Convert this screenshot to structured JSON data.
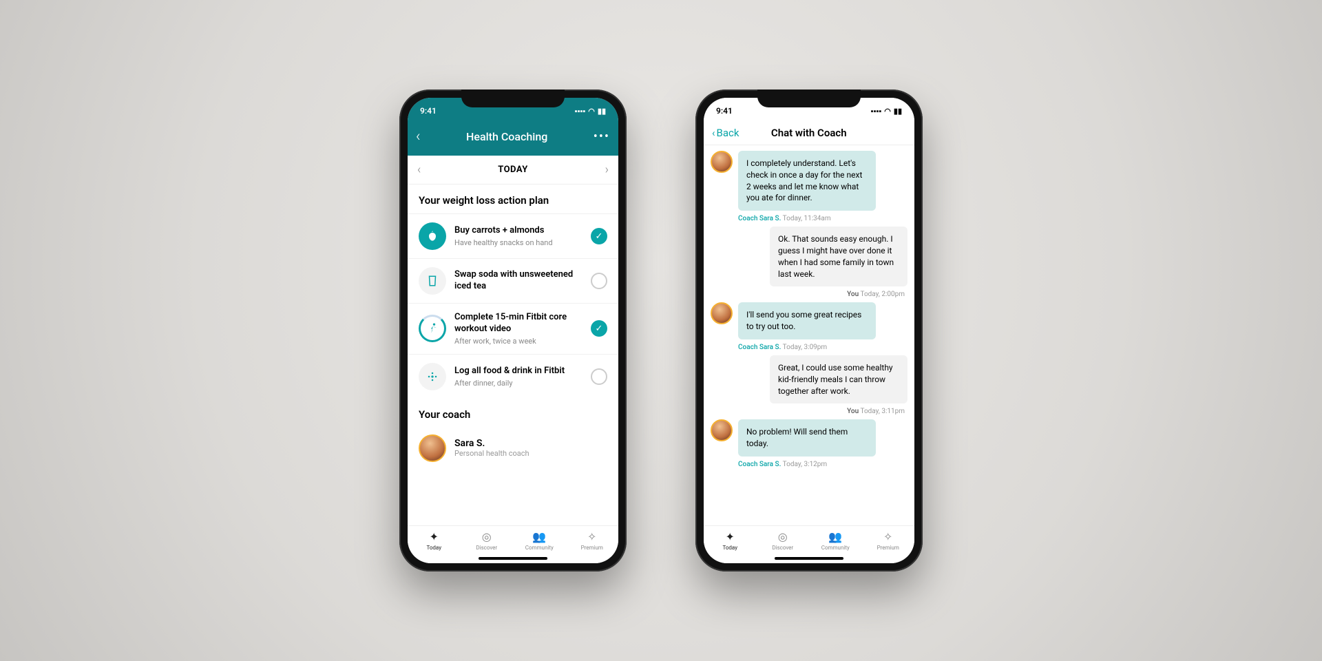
{
  "status_time": "9:41",
  "phone1": {
    "header_title": "Health Coaching",
    "day_label": "TODAY",
    "section_plan": "Your weight loss action plan",
    "tasks": [
      {
        "title": "Buy carrots + almonds",
        "sub": "Have healthy snacks on hand",
        "done": true,
        "icon": "apple"
      },
      {
        "title": "Swap soda with unsweetened iced tea",
        "sub": "",
        "done": false,
        "icon": "drink"
      },
      {
        "title": "Complete 15-min Fitbit core workout video",
        "sub": "After work, twice a week",
        "done": true,
        "icon": "run"
      },
      {
        "title": "Log all food & drink in Fitbit",
        "sub": "After dinner, daily",
        "done": false,
        "icon": "fitbit"
      }
    ],
    "section_coach": "Your coach",
    "coach_name": "Sara S.",
    "coach_role": "Personal health coach"
  },
  "phone2": {
    "back_label": "Back",
    "header_title": "Chat with Coach",
    "messages": [
      {
        "from": "coach",
        "text": "I completely understand. Let's check in once a day for the next 2 weeks and let me know what you ate for dinner.",
        "who": "Coach Sara S.",
        "time": "Today, 11:34am"
      },
      {
        "from": "me",
        "text": "Ok. That sounds easy enough. I guess I might have over done it when I had some family in town last week.",
        "who": "You",
        "time": "Today, 2:00pm"
      },
      {
        "from": "coach",
        "text": "I'll send you some great recipes to try out too.",
        "who": "Coach Sara S.",
        "time": "Today, 3:09pm"
      },
      {
        "from": "me",
        "text": "Great, I could use some healthy kid-friendly meals I can throw together after work.",
        "who": "You",
        "time": "Today, 3:11pm"
      },
      {
        "from": "coach",
        "text": "No problem! Will send them today.",
        "who": "Coach Sara S.",
        "time": "Today, 3:12pm"
      }
    ]
  },
  "tabs": [
    {
      "label": "Today",
      "active": true
    },
    {
      "label": "Discover",
      "active": false
    },
    {
      "label": "Community",
      "active": false
    },
    {
      "label": "Premium",
      "active": false
    }
  ]
}
